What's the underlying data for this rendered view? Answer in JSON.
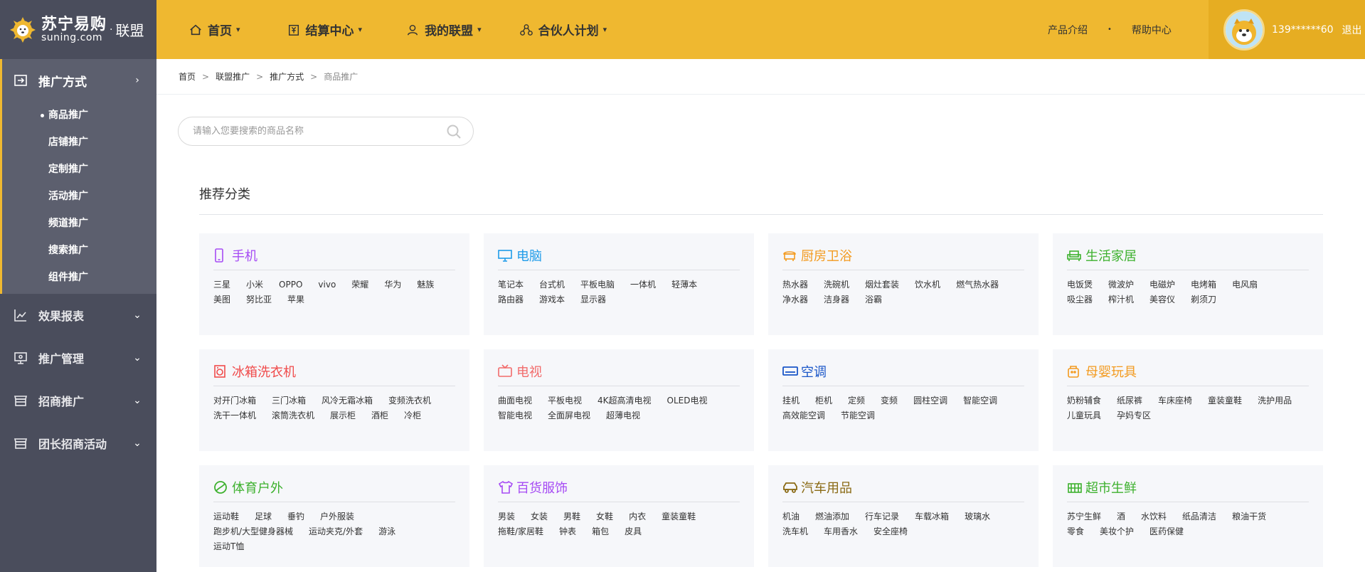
{
  "logo": {
    "cn": "苏宁易购",
    "en": "suning.com",
    "dot": "·",
    "union": "联盟"
  },
  "topnav": [
    {
      "label": "首页",
      "icon": "home-icon"
    },
    {
      "label": "结算中心",
      "icon": "settlement-icon"
    },
    {
      "label": "我的联盟",
      "icon": "user-icon"
    },
    {
      "label": "合伙人计划",
      "icon": "partner-icon"
    }
  ],
  "toplinks": {
    "product": "产品介绍",
    "sep": "•",
    "help": "帮助中心"
  },
  "user": {
    "name": "139******60",
    "logout": "退出"
  },
  "sidebar": {
    "promo": {
      "label": "推广方式",
      "arrow": "›"
    },
    "submenu": [
      "商品推广",
      "店铺推广",
      "定制推广",
      "活动推广",
      "频道推广",
      "搜索推广",
      "组件推广"
    ],
    "others": [
      {
        "label": "效果报表",
        "icon": "chart-icon"
      },
      {
        "label": "推广管理",
        "icon": "monitor-icon"
      },
      {
        "label": "招商推广",
        "icon": "store-icon"
      },
      {
        "label": "团长招商活动",
        "icon": "shop-icon"
      }
    ]
  },
  "breadcrumb": [
    "首页",
    "联盟推广",
    "推广方式",
    "商品推广"
  ],
  "search": {
    "placeholder": "请输入您要搜索的商品名称"
  },
  "section": {
    "title": "推荐分类"
  },
  "categories": [
    {
      "title": "手机",
      "color": "#a64bf4",
      "icon": "phone-icon",
      "tags": [
        "三星",
        "小米",
        "OPPO",
        "vivo",
        "荣耀",
        "华为",
        "魅族",
        "美图",
        "努比亚",
        "苹果"
      ]
    },
    {
      "title": "电脑",
      "color": "#1e9be9",
      "icon": "computer-icon",
      "tags": [
        "笔记本",
        "台式机",
        "平板电脑",
        "一体机",
        "轻薄本",
        "路由器",
        "游戏本",
        "显示器"
      ]
    },
    {
      "title": "厨房卫浴",
      "color": "#f39a1e",
      "icon": "kitchen-icon",
      "tags": [
        "热水器",
        "洗碗机",
        "烟灶套装",
        "饮水机",
        "燃气热水器",
        "净水器",
        "洁身器",
        "浴霸"
      ]
    },
    {
      "title": "生活家居",
      "color": "#3db12e",
      "icon": "sofa-icon",
      "tags": [
        "电饭煲",
        "微波炉",
        "电磁炉",
        "电烤箱",
        "电风扇",
        "吸尘器",
        "榨汁机",
        "美容仪",
        "剃须刀"
      ]
    },
    {
      "title": "冰箱洗衣机",
      "color": "#f04b4b",
      "icon": "washer-icon",
      "tags": [
        "对开门冰箱",
        "三门冰箱",
        "风冷无霜冰箱",
        "变频洗衣机",
        "洗干一体机",
        "滚筒洗衣机",
        "展示柜",
        "酒柜",
        "冷柜"
      ]
    },
    {
      "title": "电视",
      "color": "#f26b6b",
      "icon": "tv-icon",
      "tags": [
        "曲面电视",
        "平板电视",
        "4K超高清电视",
        "OLED电视",
        "智能电视",
        "全面屏电视",
        "超薄电视"
      ]
    },
    {
      "title": "空调",
      "color": "#1a56c8",
      "icon": "aircon-icon",
      "tags": [
        "挂机",
        "柜机",
        "定频",
        "变频",
        "圆柱空调",
        "智能空调",
        "高效能空调",
        "节能空调"
      ]
    },
    {
      "title": "母婴玩具",
      "color": "#f39a1e",
      "icon": "baby-icon",
      "tags": [
        "奶粉辅食",
        "纸尿裤",
        "车床座椅",
        "童装童鞋",
        "洗护用品",
        "儿童玩具",
        "孕妈专区"
      ]
    },
    {
      "title": "体育户外",
      "color": "#3db12e",
      "icon": "sports-icon",
      "tags": [
        "运动鞋",
        "足球",
        "垂钓",
        "户外服装",
        "跑步机/大型健身器械",
        "运动夹克/外套",
        "游泳",
        "运动T恤"
      ]
    },
    {
      "title": "百货服饰",
      "color": "#a64bf4",
      "icon": "clothing-icon",
      "tags": [
        "男装",
        "女装",
        "男鞋",
        "女鞋",
        "内衣",
        "童装童鞋",
        "拖鞋/家居鞋",
        "钟表",
        "箱包",
        "皮具"
      ]
    },
    {
      "title": "汽车用品",
      "color": "#8a6a14",
      "icon": "car-icon",
      "tags": [
        "机油",
        "燃油添加",
        "行车记录",
        "车载冰箱",
        "玻璃水",
        "洗车机",
        "车用香水",
        "安全座椅"
      ]
    },
    {
      "title": "超市生鲜",
      "color": "#3db12e",
      "icon": "basket-icon",
      "tags": [
        "苏宁生鲜",
        "酒",
        "水饮料",
        "纸品清洁",
        "粮油干货",
        "零食",
        "美妆个护",
        "医药保健"
      ]
    }
  ]
}
